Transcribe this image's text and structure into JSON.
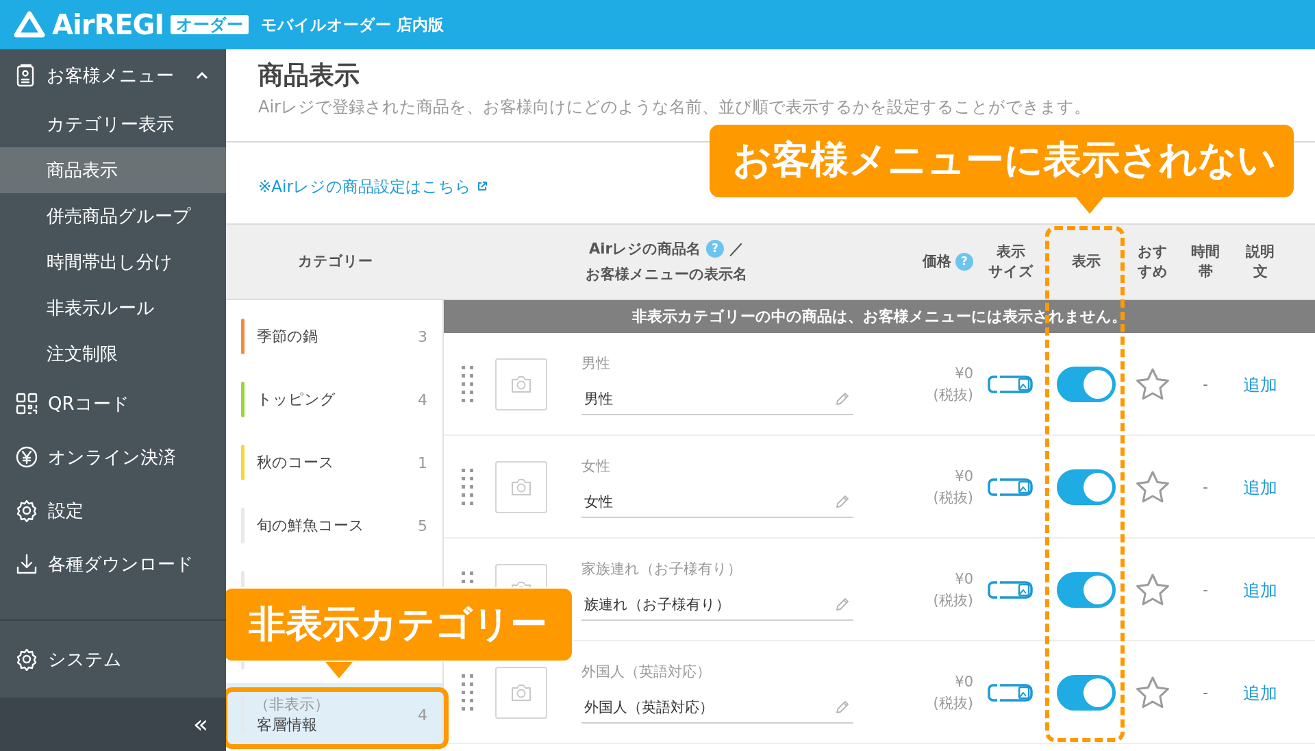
{
  "header": {
    "logo": "AirREGI",
    "badge": "オーダー",
    "subtitle": "モバイルオーダー 店内版"
  },
  "sidebar": {
    "items": [
      {
        "kind": "menu",
        "label": "お客様メニュー",
        "expanded": true,
        "children": [
          {
            "label": "カテゴリー表示",
            "selected": false
          },
          {
            "label": "商品表示",
            "selected": true
          },
          {
            "label": "併売商品グループ",
            "selected": false
          },
          {
            "label": "時間帯出し分け",
            "selected": false
          },
          {
            "label": "非表示ルール",
            "selected": false
          },
          {
            "label": "注文制限",
            "selected": false
          }
        ]
      },
      {
        "kind": "qr",
        "label": "QRコード"
      },
      {
        "kind": "payment",
        "label": "オンライン決済"
      },
      {
        "kind": "settings",
        "label": "設定"
      },
      {
        "kind": "download",
        "label": "各種ダウンロード"
      }
    ],
    "system": {
      "kind": "settings",
      "label": "システム"
    },
    "collapse": "«"
  },
  "page": {
    "title": "商品表示",
    "description": "Airレジで登録された商品を、お客様向けにどのような名前、並び順で表示するかを設定することができます。",
    "link": "※Airレジの商品設定はこちら"
  },
  "table": {
    "columns": [
      {
        "kind": "category",
        "label": "カテゴリー"
      },
      {
        "kind": "name",
        "label": "Airレジの商品名",
        "help": "?",
        "separator": "／",
        "sublabel": "お客様メニューの表示名"
      },
      {
        "kind": "price",
        "label": "価格",
        "help": "?"
      },
      {
        "kind": "plain",
        "lines": [
          "表示",
          "サイズ"
        ]
      },
      {
        "kind": "plain",
        "lines": [
          "表示"
        ]
      },
      {
        "kind": "plain",
        "lines": [
          "おす",
          "すめ"
        ]
      },
      {
        "kind": "plain",
        "lines": [
          "時間",
          "帯"
        ]
      },
      {
        "kind": "plain",
        "lines": [
          "説明",
          "文"
        ]
      }
    ]
  },
  "categories": [
    {
      "name": "季節の鍋",
      "count": "3",
      "color": "#f28b3d",
      "selected": false
    },
    {
      "name": "トッピング",
      "count": "4",
      "color": "#9ad53c",
      "selected": false
    },
    {
      "name": "秋のコース",
      "count": "1",
      "color": "#f5d63a",
      "selected": false
    },
    {
      "name": "旬の鮮魚コース",
      "count": "5",
      "color": "#e8e8e8",
      "selected": false
    },
    {
      "color": "#e8e8e8",
      "selected": false
    },
    {
      "color": "#e8e8e8",
      "selected": false
    },
    {
      "hidden_label": "（非表示）",
      "name": "客層情報",
      "count": "4",
      "color": "#e8e8e8",
      "selected": true
    }
  ],
  "notice": "非表示カテゴリーの中の商品は、お客様メニューには表示されません。",
  "products": [
    {
      "original_name": "男性",
      "display_name": "男性",
      "price": "¥0",
      "tax": "(税抜)",
      "visible": true,
      "recommended": false,
      "time": "-",
      "description": "追加"
    },
    {
      "original_name": "女性",
      "display_name": "女性",
      "price": "¥0",
      "tax": "(税抜)",
      "visible": true,
      "recommended": false,
      "time": "-",
      "description": "追加"
    },
    {
      "original_name": "家族連れ（お子様有り）",
      "display_name": "族連れ（お子様有り）",
      "price": "¥0",
      "tax": "(税抜)",
      "visible": true,
      "recommended": false,
      "time": "-",
      "description": "追加"
    },
    {
      "original_name": "外国人（英語対応）",
      "display_name": "外国人（英語対応）",
      "price": "¥0",
      "tax": "(税抜)",
      "visible": true,
      "recommended": false,
      "time": "-",
      "description": "追加"
    }
  ],
  "annotations": [
    {
      "kind": "column-callout",
      "text": "お客様メニューに表示されない"
    },
    {
      "kind": "category-callout",
      "text": "非表示カテゴリー"
    }
  ]
}
